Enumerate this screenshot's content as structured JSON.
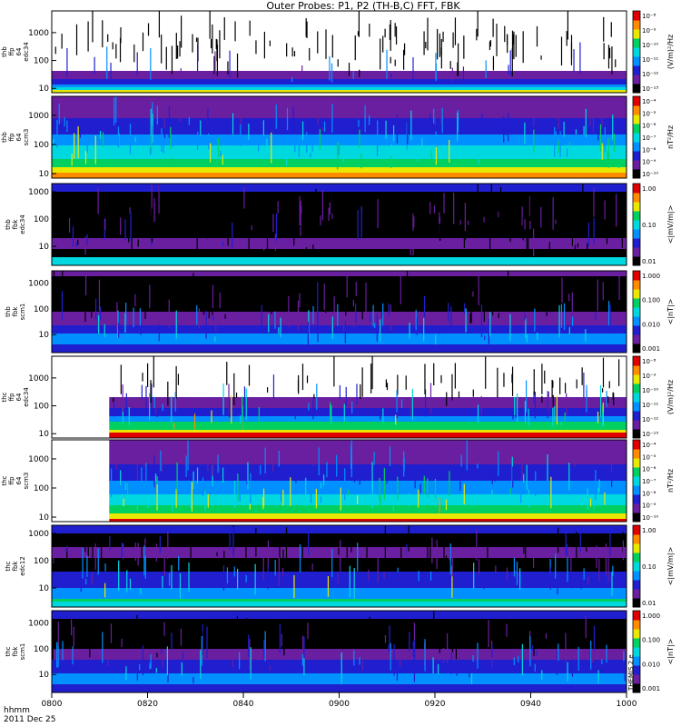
{
  "title": "Outer Probes: P1, P2 (TH-B,C) FFT, FBK",
  "footer": {
    "label_format": "hhmm",
    "date": "2011 Dec 25"
  },
  "chart_data": {
    "type": "heatmap",
    "time_axis": {
      "tick_labels": [
        "0800",
        "0820",
        "0840",
        "0900",
        "0920",
        "0940",
        "1000"
      ],
      "range_minutes": [
        0,
        120
      ]
    },
    "panels": [
      {
        "ylabel_lines": [
          "thb",
          "ffp",
          "64",
          "edc34"
        ],
        "yticks": [
          "10",
          "100",
          "1000"
        ],
        "frequency_range": [
          7,
          6000
        ],
        "cbar_label": "(V/m)²/Hz",
        "cbar_ticks": [
          "10⁻⁸",
          "10⁻⁹",
          "10⁻¹⁰",
          "10⁻¹¹",
          "10⁻¹²",
          "10⁻¹³"
        ],
        "cbar_log_range": [
          -13.6,
          -7.6
        ],
        "data_start_minute": 0
      },
      {
        "ylabel_lines": [
          "thb",
          "ffp",
          "64",
          "scm3"
        ],
        "yticks": [
          "10",
          "100",
          "1000"
        ],
        "frequency_range": [
          7,
          4500
        ],
        "cbar_label": "nT²/Hz",
        "cbar_ticks": [
          "10⁻⁴",
          "10⁻⁵",
          "10⁻⁶",
          "10⁻⁷",
          "10⁻⁸",
          "10⁻⁹",
          "10⁻¹⁰"
        ],
        "cbar_log_range": [
          -10.4,
          -4
        ],
        "data_start_minute": 0
      },
      {
        "ylabel_lines": [
          "thb",
          "fbk",
          "edc34"
        ],
        "yticks": [
          "10",
          "100",
          "1000"
        ],
        "frequency_range": [
          2,
          2000
        ],
        "cbar_label": "<|mV/m|>",
        "cbar_ticks": [
          "1.00",
          "0.10",
          "0.01"
        ],
        "cbar_log_range": [
          -2.4,
          0.2
        ],
        "data_start_minute": 0
      },
      {
        "ylabel_lines": [
          "thb",
          "fbk",
          "scm1"
        ],
        "yticks": [
          "10",
          "100",
          "1000"
        ],
        "frequency_range": [
          2,
          3000
        ],
        "cbar_label": "<|nT|>",
        "cbar_ticks": [
          "1.000",
          "0.100",
          "0.010",
          "0.001"
        ],
        "cbar_log_range": [
          -3.2,
          0.2
        ],
        "data_start_minute": 0
      },
      {
        "ylabel_lines": [
          "thc",
          "ffp",
          "64",
          "edc34"
        ],
        "yticks": [
          "10",
          "100",
          "1000"
        ],
        "frequency_range": [
          7,
          6000
        ],
        "cbar_label": "(V/m)²/Hz",
        "cbar_ticks": [
          "10⁻⁸",
          "10⁻⁹",
          "10⁻¹⁰",
          "10⁻¹¹",
          "10⁻¹²",
          "10⁻¹³"
        ],
        "cbar_log_range": [
          -13.6,
          -7.6
        ],
        "data_start_minute": 12
      },
      {
        "ylabel_lines": [
          "thc",
          "ffp",
          "64",
          "scm3"
        ],
        "yticks": [
          "10",
          "100",
          "1000"
        ],
        "frequency_range": [
          7,
          4500
        ],
        "cbar_label": "nT²/Hz",
        "cbar_ticks": [
          "10⁻⁴",
          "10⁻⁵",
          "10⁻⁶",
          "10⁻⁷",
          "10⁻⁸",
          "10⁻⁹",
          "10⁻¹⁰"
        ],
        "cbar_log_range": [
          -10.4,
          -4
        ],
        "data_start_minute": 12
      },
      {
        "ylabel_lines": [
          "thc",
          "fbk",
          "edc12"
        ],
        "yticks": [
          "10",
          "100",
          "1000"
        ],
        "frequency_range": [
          2,
          2000
        ],
        "cbar_label": "<|mV/m|>",
        "cbar_ticks": [
          "1.00",
          "0.10",
          "0.01"
        ],
        "cbar_log_range": [
          -2.4,
          0.2
        ],
        "data_start_minute": 0
      },
      {
        "ylabel_lines": [
          "thc",
          "fbk",
          "scm1"
        ],
        "yticks": [
          "10",
          "100",
          "1000"
        ],
        "frequency_range": [
          2,
          3000
        ],
        "cbar_label": "<|nT|>",
        "cbar_ticks": [
          "1.000",
          "0.100",
          "0.010",
          "0.001"
        ],
        "cbar_log_range": [
          -3.2,
          0.2
        ],
        "data_start_minute": 0
      }
    ],
    "colormap": [
      "#000000",
      "#6a1ea0",
      "#1f1fd0",
      "#0090ff",
      "#00d8e0",
      "#00d060",
      "#e8e800",
      "#ff8c00",
      "#e00000"
    ],
    "side_annotation": "THEMIS  2 e"
  }
}
